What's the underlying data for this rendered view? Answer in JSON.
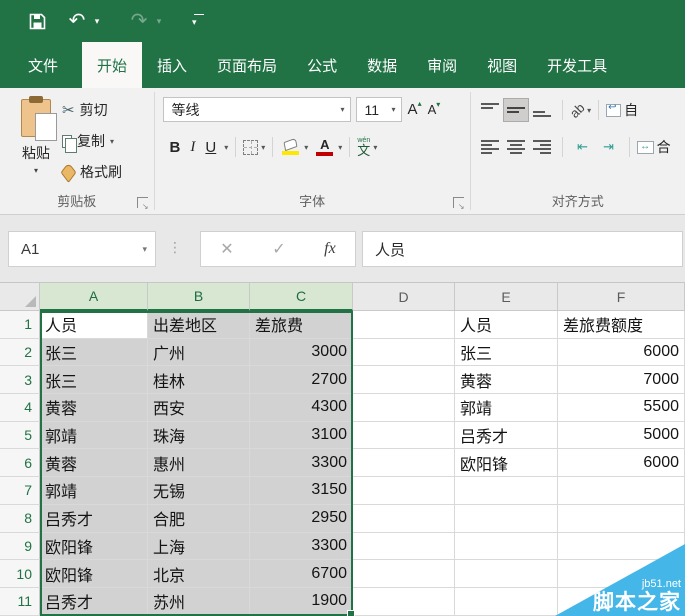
{
  "titlebar": {
    "icons": [
      "save",
      "undo",
      "redo",
      "customize-quick-access-toolbar"
    ]
  },
  "tabs": [
    {
      "label": "文件",
      "selected": false
    },
    {
      "label": "开始",
      "selected": true
    },
    {
      "label": "插入",
      "selected": false
    },
    {
      "label": "页面布局",
      "selected": false
    },
    {
      "label": "公式",
      "selected": false
    },
    {
      "label": "数据",
      "selected": false
    },
    {
      "label": "审阅",
      "selected": false
    },
    {
      "label": "视图",
      "selected": false
    },
    {
      "label": "开发工具",
      "selected": false
    }
  ],
  "ribbon": {
    "clipboard": {
      "paste": "粘贴",
      "cut": "剪切",
      "copy": "复制",
      "format_painter": "格式刷",
      "group_label": "剪贴板"
    },
    "font": {
      "name": "等线",
      "size": "11",
      "bold": "B",
      "italic": "I",
      "underline": "U",
      "font_color_letter": "A",
      "phonetic": "文",
      "phonetic_pinyin": "wén",
      "group_label": "字体"
    },
    "alignment": {
      "orientation": "ab",
      "wrap_partial": "自",
      "merge_partial": "合",
      "group_label": "对齐方式"
    }
  },
  "formula_bar": {
    "name_box": "A1",
    "fx_label": "fx",
    "value": "人员"
  },
  "grid": {
    "active_cell": "A1",
    "selected_range": "A1:C11",
    "columns": [
      {
        "letter": "A",
        "selected": true
      },
      {
        "letter": "B",
        "selected": true
      },
      {
        "letter": "C",
        "selected": true
      },
      {
        "letter": "D",
        "selected": false
      },
      {
        "letter": "E",
        "selected": false
      },
      {
        "letter": "F",
        "selected": false
      }
    ],
    "rows": [
      {
        "n": "1",
        "cells": [
          "人员",
          "出差地区",
          "差旅费",
          "",
          "人员",
          "差旅费额度"
        ]
      },
      {
        "n": "2",
        "cells": [
          "张三",
          "广州",
          "3000",
          "",
          "张三",
          "6000"
        ]
      },
      {
        "n": "3",
        "cells": [
          "张三",
          "桂林",
          "2700",
          "",
          "黄蓉",
          "7000"
        ]
      },
      {
        "n": "4",
        "cells": [
          "黄蓉",
          "西安",
          "4300",
          "",
          "郭靖",
          "5500"
        ]
      },
      {
        "n": "5",
        "cells": [
          "郭靖",
          "珠海",
          "3100",
          "",
          "吕秀才",
          "5000"
        ]
      },
      {
        "n": "6",
        "cells": [
          "黄蓉",
          "惠州",
          "3300",
          "",
          "欧阳锋",
          "6000"
        ]
      },
      {
        "n": "7",
        "cells": [
          "郭靖",
          "无锡",
          "3150",
          "",
          "",
          ""
        ]
      },
      {
        "n": "8",
        "cells": [
          "吕秀才",
          "合肥",
          "2950",
          "",
          "",
          ""
        ]
      },
      {
        "n": "9",
        "cells": [
          "欧阳锋",
          "上海",
          "3300",
          "",
          "",
          ""
        ]
      },
      {
        "n": "10",
        "cells": [
          "欧阳锋",
          "北京",
          "6700",
          "",
          "",
          ""
        ]
      },
      {
        "n": "11",
        "cells": [
          "吕秀才",
          "苏州",
          "1900",
          "",
          "",
          ""
        ]
      }
    ]
  },
  "watermark": {
    "site": "jb51.net",
    "name": "脚本之家",
    "color": "#45b6e8"
  },
  "colors": {
    "excel_green": "#217346",
    "selection_fill": "#d2d2d2",
    "selected_header_bg": "#d7e7d1"
  }
}
